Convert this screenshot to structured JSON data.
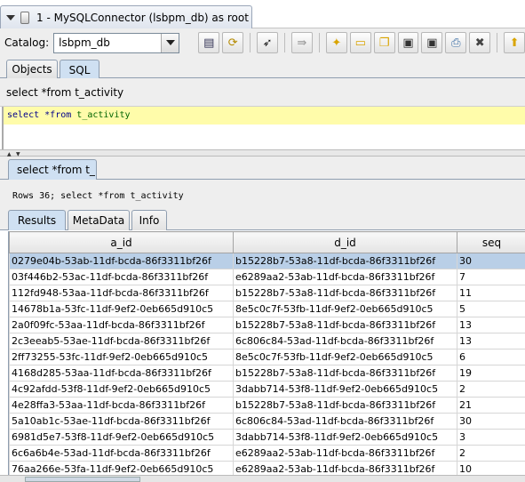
{
  "window": {
    "title": "1 - MySQLConnector (lsbpm_db) as root"
  },
  "toolbar": {
    "catalog_label": "Catalog:",
    "catalog_value": "lsbpm_db",
    "buttons": [
      {
        "icon": "execute-sql-icon",
        "glyph": "▤"
      },
      {
        "icon": "refresh-icon",
        "glyph": "⟳"
      },
      {
        "icon": "run-icon",
        "glyph": "➶"
      },
      {
        "icon": "indent-icon",
        "glyph": "⇛"
      },
      {
        "icon": "new-file-icon",
        "glyph": "✦"
      },
      {
        "icon": "open-folder-icon",
        "glyph": "▭"
      },
      {
        "icon": "copy-icon",
        "glyph": "❐"
      },
      {
        "icon": "save-icon",
        "glyph": "▣"
      },
      {
        "icon": "save-as-icon",
        "glyph": "▣"
      },
      {
        "icon": "print-icon",
        "glyph": "⎙"
      },
      {
        "icon": "close-icon",
        "glyph": "✖"
      },
      {
        "icon": "up-arrow-icon",
        "glyph": "⬆"
      }
    ]
  },
  "tabs": [
    {
      "label": "Objects"
    },
    {
      "label": "SQL"
    }
  ],
  "sql": {
    "label": "select *from t_activity",
    "keyword_select": "select",
    "star_from": "*from",
    "table_name": "t_activity"
  },
  "result_tab": {
    "label": "select *from t_"
  },
  "rows_info": "Rows 36;  select *from t_activity",
  "sub_tabs": [
    {
      "label": "Results"
    },
    {
      "label": "MetaData"
    },
    {
      "label": "Info"
    }
  ],
  "table": {
    "columns": [
      "a_id",
      "d_id",
      "seq"
    ],
    "rows": [
      [
        "0279e04b-53ab-11df-bcda-86f3311bf26f",
        "b15228b7-53a8-11df-bcda-86f3311bf26f",
        "30"
      ],
      [
        "03f446b2-53ac-11df-bcda-86f3311bf26f",
        "e6289aa2-53ab-11df-bcda-86f3311bf26f",
        "7"
      ],
      [
        "112fd948-53aa-11df-bcda-86f3311bf26f",
        "b15228b7-53a8-11df-bcda-86f3311bf26f",
        "11"
      ],
      [
        "14678b1a-53fc-11df-9ef2-0eb665d910c5",
        "8e5c0c7f-53fb-11df-9ef2-0eb665d910c5",
        "5"
      ],
      [
        "2a0f09fc-53aa-11df-bcda-86f3311bf26f",
        "b15228b7-53a8-11df-bcda-86f3311bf26f",
        "13"
      ],
      [
        "2c3eeab5-53ae-11df-bcda-86f3311bf26f",
        "6c806c84-53ad-11df-bcda-86f3311bf26f",
        "13"
      ],
      [
        "2ff73255-53fc-11df-9ef2-0eb665d910c5",
        "8e5c0c7f-53fb-11df-9ef2-0eb665d910c5",
        "6"
      ],
      [
        "4168d285-53aa-11df-bcda-86f3311bf26f",
        "b15228b7-53a8-11df-bcda-86f3311bf26f",
        "19"
      ],
      [
        "4c92afdd-53f8-11df-9ef2-0eb665d910c5",
        "3dabb714-53f8-11df-9ef2-0eb665d910c5",
        "2"
      ],
      [
        "4e28ffa3-53aa-11df-bcda-86f3311bf26f",
        "b15228b7-53a8-11df-bcda-86f3311bf26f",
        "21"
      ],
      [
        "5a10ab1c-53ae-11df-bcda-86f3311bf26f",
        "6c806c84-53ad-11df-bcda-86f3311bf26f",
        "30"
      ],
      [
        "6981d5e7-53f8-11df-9ef2-0eb665d910c5",
        "3dabb714-53f8-11df-9ef2-0eb665d910c5",
        "3"
      ],
      [
        "6c6a6b4e-53ad-11df-bcda-86f3311bf26f",
        "e6289aa2-53ab-11df-bcda-86f3311bf26f",
        "2"
      ],
      [
        "76aa266e-53fa-11df-9ef2-0eb665d910c5",
        "e6289aa2-53ab-11df-bcda-86f3311bf26f",
        "10"
      ]
    ]
  }
}
